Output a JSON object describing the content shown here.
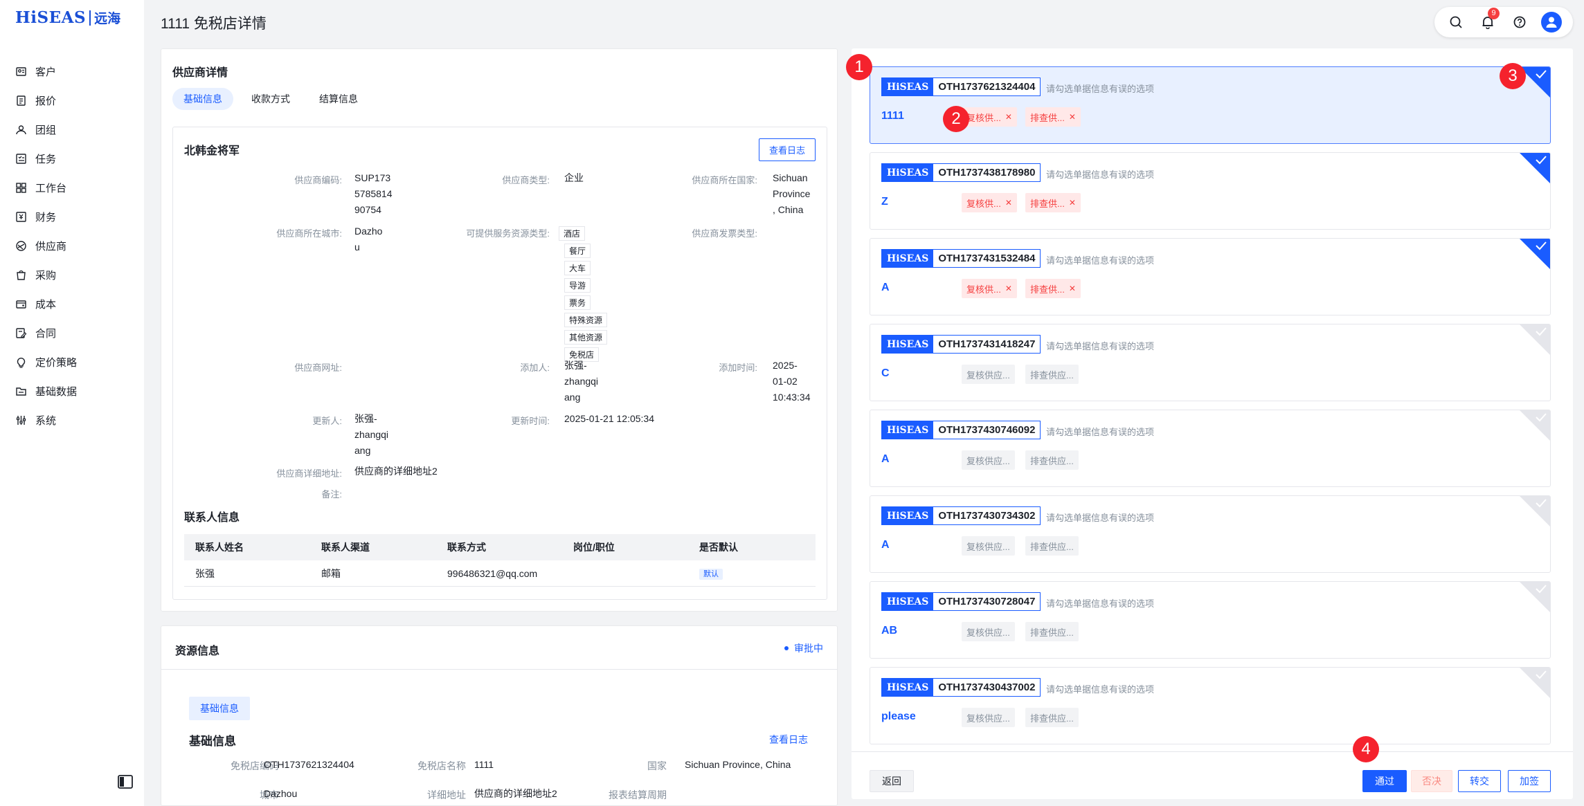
{
  "sidebar": {
    "logo_en": "HiSEAS",
    "logo_cn": "远海",
    "items": [
      {
        "label": "客户",
        "icon": "customer-icon"
      },
      {
        "label": "报价",
        "icon": "quote-icon"
      },
      {
        "label": "团组",
        "icon": "group-icon"
      },
      {
        "label": "任务",
        "icon": "task-icon"
      },
      {
        "label": "工作台",
        "icon": "workbench-icon"
      },
      {
        "label": "财务",
        "icon": "finance-icon"
      },
      {
        "label": "供应商",
        "icon": "supplier-icon"
      },
      {
        "label": "采购",
        "icon": "purchase-icon"
      },
      {
        "label": "成本",
        "icon": "cost-icon"
      },
      {
        "label": "合同",
        "icon": "contract-icon"
      },
      {
        "label": "定价策略",
        "icon": "pricing-icon"
      },
      {
        "label": "基础数据",
        "icon": "base-data-icon"
      },
      {
        "label": "系统",
        "icon": "system-icon"
      }
    ]
  },
  "header": {
    "title": "1111 免税店详情",
    "notification_count": "9"
  },
  "supplier": {
    "section_title": "供应商详情",
    "tabs": [
      "基础信息",
      "收款方式",
      "结算信息"
    ],
    "name": "北韩金将军",
    "log_button": "查看日志",
    "fields": {
      "code_label": "供应商编码:",
      "code_lines": [
        "SUP173",
        "5785814",
        "90754"
      ],
      "type_label": "供应商类型:",
      "type_value": "企业",
      "country_label": "供应商所在国家:",
      "country_lines": [
        "Sichuan",
        "Province",
        ", China"
      ],
      "city_label": "供应商所在城市:",
      "city_lines": [
        "Dazho",
        "u"
      ],
      "resource_label": "可提供服务资源类型:",
      "resource_types": [
        "酒店",
        "餐厅",
        "大车",
        "导游",
        "票务",
        "特殊资源",
        "其他资源",
        "免税店"
      ],
      "invoice_label": "供应商发票类型:",
      "website_label": "供应商网址:",
      "adder_label": "添加人:",
      "adder_lines": [
        "张强-",
        "zhangqi",
        "ang"
      ],
      "add_time_label": "添加时间:",
      "add_time_lines": [
        "2025-",
        "01-02",
        "10:43:34"
      ],
      "updater_label": "更新人:",
      "updater_lines": [
        "张强-",
        "zhangqi",
        "ang"
      ],
      "update_time_label": "更新时间:",
      "update_time_value": "2025-01-21 12:05:34",
      "address_label": "供应商详细地址:",
      "address_value": "供应商的详细地址2",
      "remark_label": "备注:"
    },
    "contact_title": "联系人信息",
    "contact_headers": [
      "联系人姓名",
      "联系人渠道",
      "联系方式",
      "岗位/职位",
      "是否默认"
    ],
    "contact_rows": [
      {
        "name": "张强",
        "channel": "邮箱",
        "contact": "996486321@qq.com",
        "position": "",
        "default": "默认"
      }
    ]
  },
  "resource": {
    "title": "资源信息",
    "status": "审批中",
    "tab": "基础信息",
    "sub_title": "基础信息",
    "log_link": "查看日志",
    "row": {
      "code_label": "免税店编码",
      "code_value": "OTH1737621324404",
      "name_label": "免税店名称",
      "name_value": "1111",
      "country_label": "国家",
      "country_value": "Sichuan Province, China",
      "city_label": "城市",
      "city_value": "Dazhou",
      "address_label": "详细地址",
      "address_value": "供应商的详细地址2",
      "settle_label": "报表结算周期"
    }
  },
  "approvals": {
    "brand": "HiSEAS",
    "hint": "请勾选单据信息有误的选项",
    "items": [
      {
        "code": "OTH1737621324404",
        "name": "1111",
        "chip1": "复核供...",
        "chip2": "排查供...",
        "error": true,
        "checked": true,
        "selected": true
      },
      {
        "code": "OTH1737438178980",
        "name": "Z",
        "chip1": "复核供...",
        "chip2": "排查供...",
        "error": true,
        "checked": true,
        "selected": false
      },
      {
        "code": "OTH1737431532484",
        "name": "A",
        "chip1": "复核供...",
        "chip2": "排查供...",
        "error": true,
        "checked": true,
        "selected": false
      },
      {
        "code": "OTH1737431418247",
        "name": "C",
        "chip1": "复核供应...",
        "chip2": "排查供应...",
        "error": false,
        "checked": false,
        "selected": false
      },
      {
        "code": "OTH1737430746092",
        "name": "A",
        "chip1": "复核供应...",
        "chip2": "排查供应...",
        "error": false,
        "checked": false,
        "selected": false
      },
      {
        "code": "OTH1737430734302",
        "name": "A",
        "chip1": "复核供应...",
        "chip2": "排查供应...",
        "error": false,
        "checked": false,
        "selected": false
      },
      {
        "code": "OTH1737430728047",
        "name": "AB",
        "chip1": "复核供应...",
        "chip2": "排查供应...",
        "error": false,
        "checked": false,
        "selected": false
      },
      {
        "code": "OTH1737430437002",
        "name": "please",
        "chip1": "复核供应...",
        "chip2": "排查供应...",
        "error": false,
        "checked": false,
        "selected": false
      }
    ],
    "buttons": {
      "back": "返回",
      "pass": "通过",
      "reject": "否决",
      "transfer": "转交",
      "countersign": "加签"
    }
  },
  "markers": [
    "1",
    "2",
    "3",
    "4"
  ],
  "colors": {
    "primary": "#1a5cff",
    "error": "#f53f3f",
    "marker": "#f5222d"
  }
}
